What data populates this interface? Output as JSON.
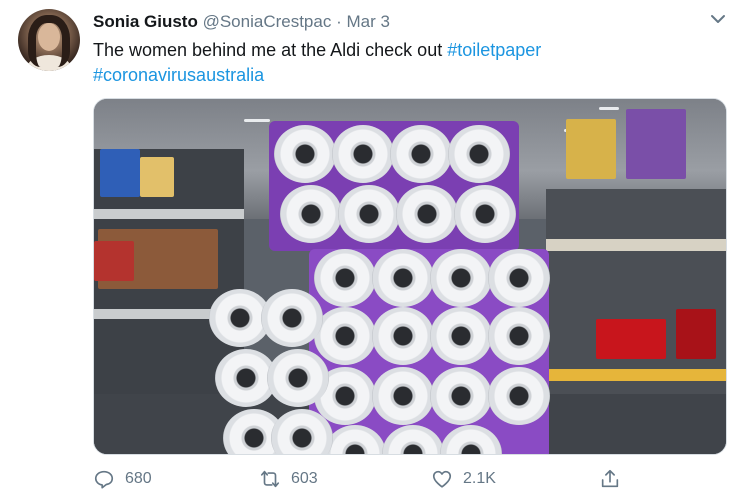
{
  "tweet": {
    "author_name": "Sonia Giusto",
    "author_handle": "@SoniaCrestpac",
    "separator": "·",
    "date": "Mar 3",
    "text_plain": "The women behind me at the Aldi check out ",
    "hashtag_1": "#toiletpaper",
    "hashtag_2": "#coronavirusaustralia"
  },
  "media": {
    "icon": "photo-toilet-paper-packs-in-supermarket"
  },
  "actions": {
    "replies": "680",
    "retweets": "603",
    "likes": "2.1K"
  },
  "colors": {
    "accent": "#1b95e0",
    "muted": "#657786"
  }
}
